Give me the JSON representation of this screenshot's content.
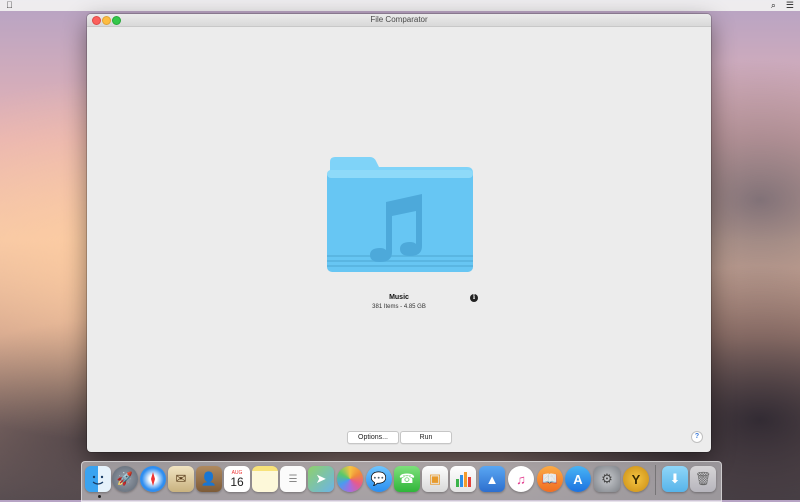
{
  "menubar": {
    "apple_icon": "",
    "search_icon": "⌕",
    "list_icon": "☰"
  },
  "window": {
    "title": "File Comparator",
    "folder": {
      "name": "Music",
      "meta": "381 Items - 4.85 GB",
      "icon": "music-folder-icon",
      "color": "#6ecbf5"
    },
    "info_label": "i",
    "buttons": {
      "options": "Options...",
      "run": "Run"
    },
    "help_label": "?"
  },
  "dock": {
    "calendar": {
      "month": "AUG",
      "day": "16"
    },
    "apps": [
      "finder",
      "launchpad",
      "safari",
      "mail-stamp",
      "contacts",
      "calendar",
      "notes",
      "reminders",
      "maps",
      "photos",
      "messages",
      "facetime",
      "preview",
      "numbers",
      "keynote",
      "itunes",
      "ibooks",
      "app-store",
      "system-preferences",
      "file-comparator"
    ],
    "trailing": [
      "downloads-folder",
      "trash"
    ]
  }
}
